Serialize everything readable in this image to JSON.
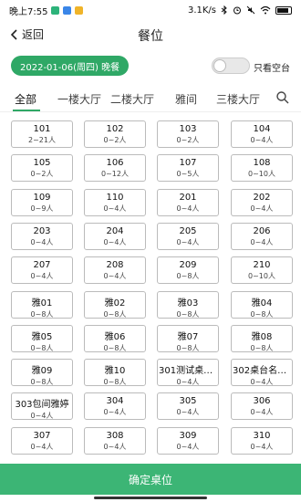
{
  "status": {
    "time": "晚上7:55",
    "network": "3.1K/s",
    "app_colors": [
      "#2db37a",
      "#3a86e8",
      "#f0b429"
    ]
  },
  "nav": {
    "back_label": "返回",
    "title": "餐位"
  },
  "filter": {
    "date_label": "2022-01-06(周四) 晚餐",
    "toggle_label": "只看空台",
    "toggle_on": false
  },
  "tabs": [
    {
      "label": "全部",
      "active": true
    },
    {
      "label": "一楼大厅"
    },
    {
      "label": "二楼大厅"
    },
    {
      "label": "雅间"
    },
    {
      "label": "三楼大厅"
    }
  ],
  "tables": [
    {
      "name": "101",
      "cap": "2~21人"
    },
    {
      "name": "102",
      "cap": "0~2人"
    },
    {
      "name": "103",
      "cap": "0~2人"
    },
    {
      "name": "104",
      "cap": "0~4人"
    },
    {
      "name": "105",
      "cap": "0~2人"
    },
    {
      "name": "106",
      "cap": "0~12人"
    },
    {
      "name": "107",
      "cap": "0~5人"
    },
    {
      "name": "108",
      "cap": "0~10人"
    },
    {
      "name": "109",
      "cap": "0~9人"
    },
    {
      "name": "110",
      "cap": "0~4人"
    },
    {
      "name": "201",
      "cap": "0~4人"
    },
    {
      "name": "202",
      "cap": "0~4人"
    },
    {
      "name": "203",
      "cap": "0~4人"
    },
    {
      "name": "204",
      "cap": "0~4人"
    },
    {
      "name": "205",
      "cap": "0~4人"
    },
    {
      "name": "206",
      "cap": "0~4人"
    },
    {
      "name": "207",
      "cap": "0~4人"
    },
    {
      "name": "208",
      "cap": "0~4人"
    },
    {
      "name": "209",
      "cap": "0~8人"
    },
    {
      "name": "210",
      "cap": "0~10人"
    },
    {
      "name": "雅01",
      "cap": "0~8人"
    },
    {
      "name": "雅02",
      "cap": "0~8人"
    },
    {
      "name": "雅03",
      "cap": "0~8人"
    },
    {
      "name": "雅04",
      "cap": "0~8人"
    },
    {
      "name": "雅05",
      "cap": "0~8人"
    },
    {
      "name": "雅06",
      "cap": "0~8人"
    },
    {
      "name": "雅07",
      "cap": "0~8人"
    },
    {
      "name": "雅08",
      "cap": "0~8人"
    },
    {
      "name": "雅09",
      "cap": "0~8人"
    },
    {
      "name": "雅10",
      "cap": "0~8人"
    },
    {
      "name": "301测试桌台...",
      "cap": "0~4人"
    },
    {
      "name": "302桌台名字...",
      "cap": "0~4人"
    },
    {
      "name": "303包间雅婷",
      "cap": "0~4人"
    },
    {
      "name": "304",
      "cap": "0~4人"
    },
    {
      "name": "305",
      "cap": "0~4人"
    },
    {
      "name": "306",
      "cap": "0~4人"
    },
    {
      "name": "307",
      "cap": "0~4人"
    },
    {
      "name": "308",
      "cap": "0~4人"
    },
    {
      "name": "309",
      "cap": "0~4人"
    },
    {
      "name": "310",
      "cap": "0~4人"
    }
  ],
  "confirm_label": "确定桌位"
}
